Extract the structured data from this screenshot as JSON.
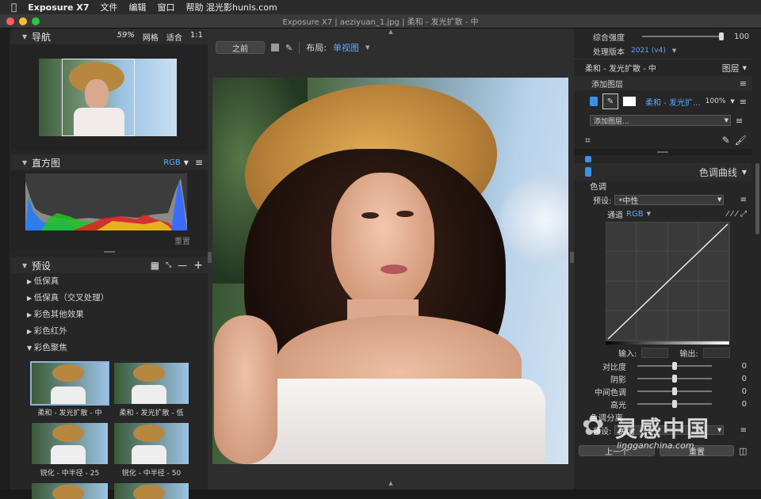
{
  "menubar": {
    "apple": "",
    "app": "Exposure X7",
    "items": [
      "文件",
      "编辑",
      "窗口",
      "帮助 混光影hunls.com"
    ]
  },
  "window": {
    "title": "Exposure X7 | aeziyuan_1.jpg | 柔和 - 发光扩散 - 中"
  },
  "navigator": {
    "title": "导航",
    "zoom": "59%",
    "grid": "网格",
    "fit": "适合",
    "one_to_one": "1:1"
  },
  "histogram": {
    "title": "直方图",
    "mode": "RGB",
    "reset": "重置"
  },
  "presets": {
    "title": "预设",
    "groups": [
      {
        "label": "低保真",
        "expanded": false
      },
      {
        "label": "低保真（交叉处理）",
        "expanded": false
      },
      {
        "label": "彩色其他效果",
        "expanded": false
      },
      {
        "label": "彩色红外",
        "expanded": false
      },
      {
        "label": "彩色聚焦",
        "expanded": true
      }
    ],
    "thumbs": [
      "柔和 - 发光扩散 - 中",
      "柔和 - 发光扩散 - 低",
      "锐化 - 中半径 - 25",
      "锐化 - 中半径 - 50",
      "",
      ""
    ]
  },
  "toolbar": {
    "before": "之前",
    "layout_label": "布局:",
    "layout_value": "单视图"
  },
  "right_top": {
    "strength_label": "综合强度",
    "strength_value": "100",
    "strength": 1.0,
    "version_label": "处理版本",
    "version_value": "2021 (v4)"
  },
  "layers": {
    "title": "柔和 - 发光扩散 - 中",
    "tab": "图层",
    "add_layer": "添加图层",
    "layer_name": "柔和 - 发光扩...",
    "layer_opacity": "100%",
    "add_layer_dropdown": "添加图层..."
  },
  "curves": {
    "title": "色调曲线",
    "section": "色调",
    "preset_label": "预设:",
    "preset_value": "*中性",
    "channel_label": "通道",
    "channel_value": "RGB",
    "input_label": "输入:",
    "output_label": "输出:",
    "input_value": "",
    "output_value": ""
  },
  "tone_sliders": [
    {
      "label": "对比度",
      "value": "0",
      "pos": 0.5
    },
    {
      "label": "阴影",
      "value": "0",
      "pos": 0.5
    },
    {
      "label": "中间色调",
      "value": "0",
      "pos": 0.5
    },
    {
      "label": "高光",
      "value": "0",
      "pos": 0.5
    }
  ],
  "split": {
    "title": "色调分离",
    "preset_label": "预设:",
    "preset_value": "关闭"
  },
  "footer": {
    "prev": "上一个",
    "reset": "重置"
  },
  "watermark": {
    "text": "灵感中国",
    "sub": "lingganchina.com"
  },
  "colors": {
    "accent": "#5aa9ff",
    "panel": "#262626"
  }
}
